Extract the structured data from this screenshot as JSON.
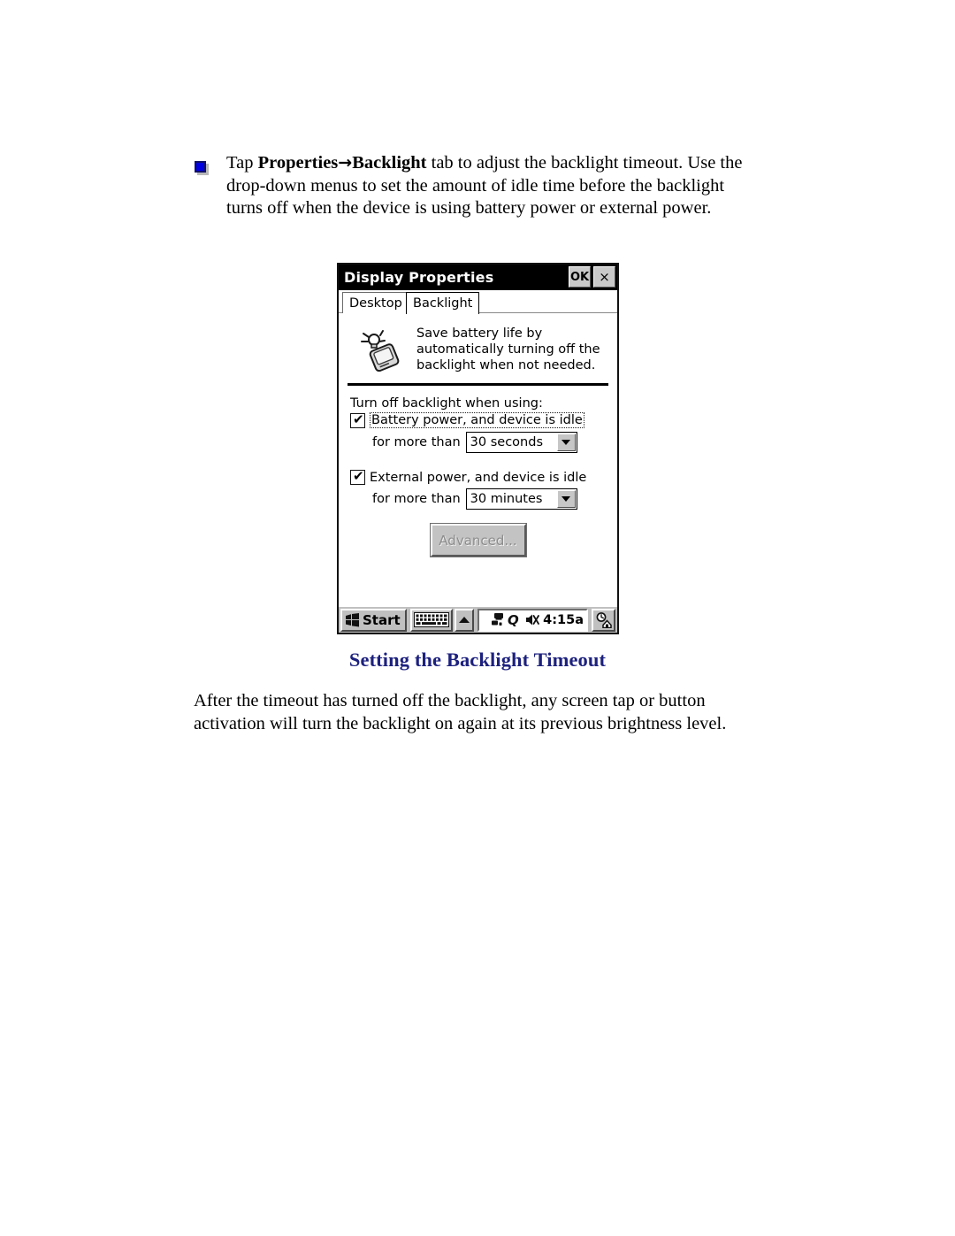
{
  "document": {
    "bullet": {
      "icon": "blue-square-bullet",
      "text_before_bold": "Tap ",
      "bold_1": "Properties",
      "arrow": "→",
      "bold_2": "Backlight",
      "text_after_bold": " tab to adjust the backlight timeout. Use the drop-down menus to set the amount of idle time before the backlight turns off when the device is using battery power or external power."
    },
    "heading": "Setting the Backlight Timeout",
    "heading_color": "#1d217e",
    "closing_paragraph": "After the timeout has turned off the backlight, any screen tap or button activation will turn the backlight on again at its previous brightness level."
  },
  "screenshot": {
    "titlebar": {
      "title": "Display Properties",
      "ok_label": "OK",
      "close_label": "×"
    },
    "tabs": [
      {
        "label": "Desktop",
        "active": false
      },
      {
        "label": "Backlight",
        "active": true
      }
    ],
    "info": {
      "icon": "backlight-device-bulb-icon",
      "line1": "Save battery life by",
      "line2": "automatically turning off the",
      "line3": "backlight when not needed."
    },
    "group_label": "Turn off backlight when using:",
    "options": [
      {
        "checked": true,
        "check_glyph": "✔",
        "label": "Battery power, and device is idle",
        "focused": true,
        "prefix": "for more than",
        "value": "30 seconds"
      },
      {
        "checked": true,
        "check_glyph": "✔",
        "label": "External power, and device is idle",
        "focused": false,
        "prefix": "for more than",
        "value": "30 minutes"
      }
    ],
    "advanced_button": {
      "label": "Advanced...",
      "disabled": true
    },
    "taskbar": {
      "start_label": "Start",
      "start_icon": "windows-flag-icon",
      "keyboard_icon": "keyboard-icon",
      "up_icon": "chevron-up-icon",
      "tray_icons": [
        "network-connection-icon",
        "q-logo-icon",
        "speaker-muted-icon"
      ],
      "time": "4:15a",
      "home_icon": "clock-home-icon"
    }
  }
}
